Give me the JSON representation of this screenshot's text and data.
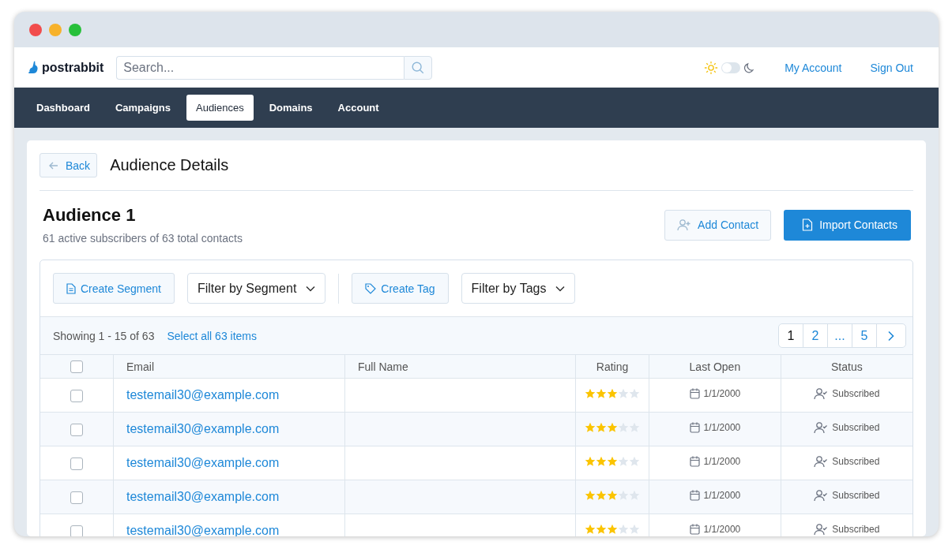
{
  "brand": {
    "name": "postrabbit"
  },
  "search": {
    "placeholder": "Search..."
  },
  "theme_toggle": {
    "on": false
  },
  "header_links": [
    "My Account",
    "Sign Out"
  ],
  "nav_tabs": [
    {
      "label": "Dashboard",
      "selected": false
    },
    {
      "label": "Campaigns",
      "selected": false
    },
    {
      "label": "Audiences",
      "selected": true
    },
    {
      "label": "Domains",
      "selected": false
    },
    {
      "label": "Account",
      "selected": false
    }
  ],
  "page": {
    "back_label": "Back",
    "title": "Audience Details"
  },
  "audience": {
    "name": "Audience 1",
    "summary": "61 active subscribers of 63 total contacts"
  },
  "actions": [
    {
      "label": "Add Contact",
      "kind": "secondary"
    },
    {
      "label": "Import Contacts",
      "kind": "primary"
    }
  ],
  "toolbar": [
    {
      "label": "Create Segment",
      "kind": "button"
    },
    {
      "label": "Filter by Segment",
      "kind": "dropdown"
    },
    {
      "kind": "divider"
    },
    {
      "label": "Create Tag",
      "kind": "tag-button"
    },
    {
      "label": "Filter by Tags",
      "kind": "dropdown"
    }
  ],
  "showing": "Showing 1 - 15 of 63",
  "select_all": "Select all 63 items",
  "pagination": [
    {
      "label": "1",
      "selected": true
    },
    {
      "label": "2",
      "selected": false
    },
    {
      "label": "...",
      "selected": false
    },
    {
      "label": "5",
      "selected": false
    }
  ],
  "table": {
    "header_checked": false,
    "columns": [
      "Email",
      "Full Name",
      "Rating",
      "Last Open",
      "Status"
    ],
    "rows": [
      {
        "checked": false,
        "email": "testemail30@example.com",
        "stars": 3,
        "last_open": "1/1/2000",
        "status": "Subscribed"
      },
      {
        "checked": false,
        "email": "testemail30@example.com",
        "stars": 3,
        "last_open": "1/1/2000",
        "status": "Subscribed"
      },
      {
        "checked": false,
        "email": "testemail30@example.com",
        "stars": 3,
        "last_open": "1/1/2000",
        "status": "Subscribed"
      },
      {
        "checked": false,
        "email": "testemail30@example.com",
        "stars": 3,
        "last_open": "1/1/2000",
        "status": "Subscribed"
      },
      {
        "checked": false,
        "email": "testemail30@example.com",
        "stars": 3,
        "last_open": "1/1/2000",
        "status": "Subscribed"
      }
    ]
  }
}
